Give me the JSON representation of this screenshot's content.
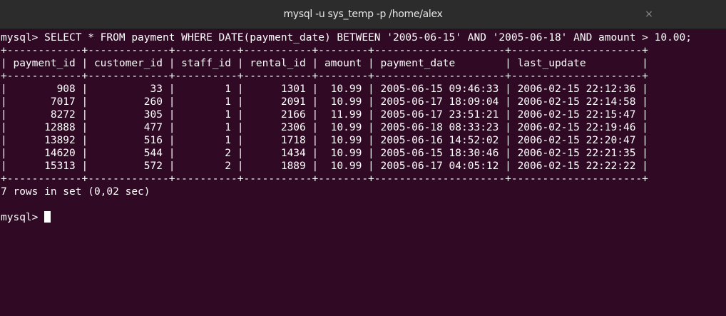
{
  "window": {
    "title": "mysql -u sys_temp -p /home/alex",
    "close_label": "×"
  },
  "terminal": {
    "command_line": "mysql> SELECT * FROM payment WHERE DATE(payment_date) BETWEEN '2005-06-15' AND '2005-06-18' AND amount > 10.00;",
    "border": "+------------+-------------+----------+-----------+--------+---------------------+---------------------+",
    "header": "| payment_id | customer_id | staff_id | rental_id | amount | payment_date        | last_update         |",
    "columns": [
      "payment_id",
      "customer_id",
      "staff_id",
      "rental_id",
      "amount",
      "payment_date",
      "last_update"
    ],
    "rows": [
      "|        908 |          33 |        1 |      1301 |  10.99 | 2005-06-15 09:46:33 | 2006-02-15 22:12:36 |",
      "|       7017 |         260 |        1 |      2091 |  10.99 | 2005-06-17 18:09:04 | 2006-02-15 22:14:58 |",
      "|       8272 |         305 |        1 |      2166 |  11.99 | 2005-06-17 23:51:21 | 2006-02-15 22:15:47 |",
      "|      12888 |         477 |        1 |      2306 |  10.99 | 2005-06-18 08:33:23 | 2006-02-15 22:19:46 |",
      "|      13892 |         516 |        1 |      1718 |  10.99 | 2005-06-16 14:52:02 | 2006-02-15 22:20:47 |",
      "|      14620 |         544 |        2 |      1434 |  10.99 | 2005-06-15 18:30:46 | 2006-02-15 22:21:35 |",
      "|      15313 |         572 |        2 |      1889 |  10.99 | 2005-06-17 04:05:12 | 2006-02-15 22:22:22 |"
    ],
    "result_summary": "7 rows in set (0,02 sec)",
    "prompt": "mysql> "
  },
  "colors": {
    "background": "#300a24",
    "titlebar": "#2c2c2c",
    "text": "#ffffff"
  }
}
